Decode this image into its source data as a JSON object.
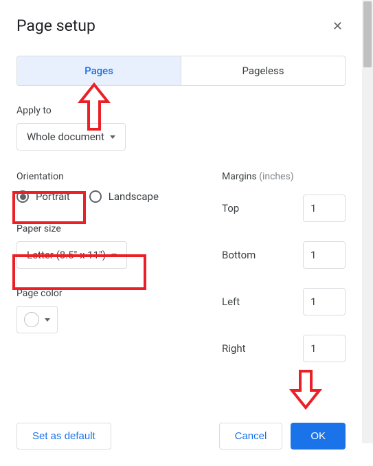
{
  "dialog": {
    "title": "Page setup"
  },
  "tabs": {
    "pages": "Pages",
    "pageless": "Pageless"
  },
  "apply_to": {
    "label": "Apply to",
    "value": "Whole document"
  },
  "orientation": {
    "label": "Orientation",
    "portrait": "Portrait",
    "landscape": "Landscape",
    "selected": "portrait"
  },
  "paper_size": {
    "label": "Paper size",
    "value": "Letter (8.5\" x 11\")"
  },
  "page_color": {
    "label": "Page color",
    "value": "#ffffff"
  },
  "margins": {
    "label": "Margins",
    "unit": "(inches)",
    "top_label": "Top",
    "top_value": "1",
    "bottom_label": "Bottom",
    "bottom_value": "1",
    "left_label": "Left",
    "left_value": "1",
    "right_label": "Right",
    "right_value": "1"
  },
  "buttons": {
    "set_default": "Set as default",
    "cancel": "Cancel",
    "ok": "OK"
  },
  "annotations": {
    "color": "#eb2027",
    "boxes": [
      "portrait-radio",
      "paper-size-dropdown"
    ],
    "arrows": [
      "pages-tab-down",
      "ok-button-down"
    ]
  }
}
